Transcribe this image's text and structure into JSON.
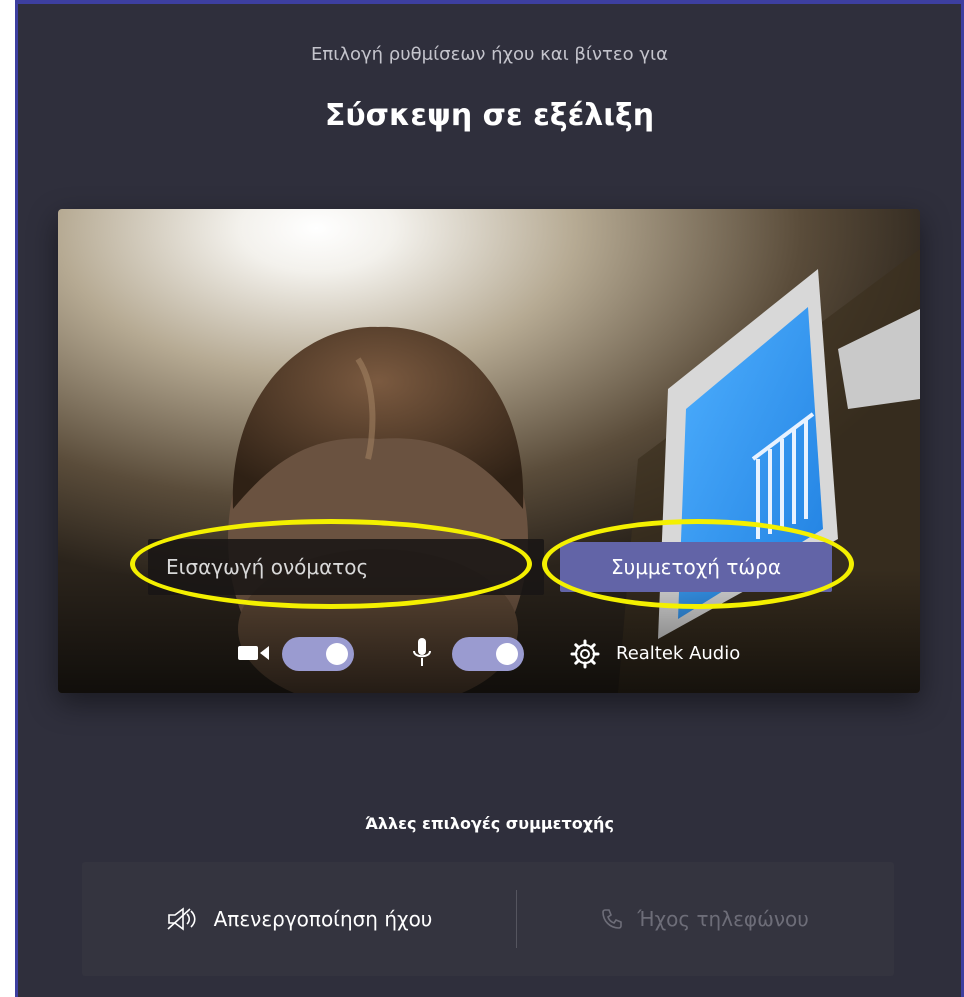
{
  "header": {
    "subtitle": "Επιλογή ρυθμίσεων ήχου και βίντεο για",
    "title": "Σύσκεψη σε εξέλιξη"
  },
  "preview": {
    "name_input": {
      "placeholder": "Εισαγωγή ονόματος",
      "value": ""
    },
    "join_button_label": "Συμμετοχή τώρα",
    "camera_toggle_on": true,
    "mic_toggle_on": true,
    "audio_device_label": "Realtek Audio"
  },
  "other_options": {
    "title": "Άλλες επιλογές συμμετοχής",
    "audio_off_label": "Απενεργοποίηση ήχου",
    "phone_audio_label": "Ήχος τηλεφώνου"
  },
  "colors": {
    "background": "#2f2f3c",
    "accent": "#6264a7",
    "toggle_on": "#9a9bd0",
    "highlight": "#f4f000"
  },
  "icons": [
    "camera-icon",
    "microphone-icon",
    "gear-icon",
    "speaker-off-icon",
    "phone-icon"
  ]
}
